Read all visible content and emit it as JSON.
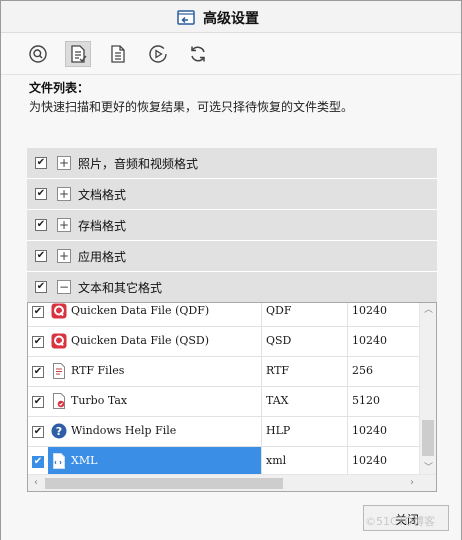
{
  "window": {
    "title": "高级设置"
  },
  "toolbar": {
    "buttons": [
      {
        "icon": "search-icon"
      },
      {
        "icon": "file-list-icon",
        "active": true
      },
      {
        "icon": "document-icon"
      },
      {
        "icon": "play-icon"
      },
      {
        "icon": "refresh-icon"
      }
    ]
  },
  "file_list": {
    "title": "文件列表：",
    "description": "为快速扫描和更好的恢复结果，可选只择待恢复的文件类型。",
    "categories": [
      {
        "label": "照片，音频和视频格式",
        "checked": true,
        "expanded": false
      },
      {
        "label": "文档格式",
        "checked": true,
        "expanded": false
      },
      {
        "label": "存档格式",
        "checked": true,
        "expanded": false
      },
      {
        "label": "应用格式",
        "checked": true,
        "expanded": false
      },
      {
        "label": "文本和其它格式",
        "checked": true,
        "expanded": true
      }
    ],
    "rows": [
      {
        "name": "Quicken Data File (QDF)",
        "ext": "QDF",
        "size": "10240",
        "checked": true,
        "icon": "quicken-icon"
      },
      {
        "name": "Quicken Data File (QSD)",
        "ext": "QSD",
        "size": "10240",
        "checked": true,
        "icon": "quicken-icon"
      },
      {
        "name": "RTF Files",
        "ext": "RTF",
        "size": "256",
        "checked": true,
        "icon": "rtf-file-icon"
      },
      {
        "name": "Turbo Tax",
        "ext": "TAX",
        "size": "5120",
        "checked": true,
        "icon": "turbotax-icon"
      },
      {
        "name": "Windows Help File",
        "ext": "HLP",
        "size": "10240",
        "checked": true,
        "icon": "help-icon"
      },
      {
        "name": "XML",
        "ext": "xml",
        "size": "10240",
        "checked": true,
        "icon": "xml-file-icon",
        "selected": true
      }
    ]
  },
  "footer": {
    "close_label": "关闭"
  },
  "watermark": "©51CTO博客",
  "colors": {
    "accent": "#3a8ee6",
    "category_bg": "#e1e1e1",
    "quicken_red": "#d9333f"
  }
}
